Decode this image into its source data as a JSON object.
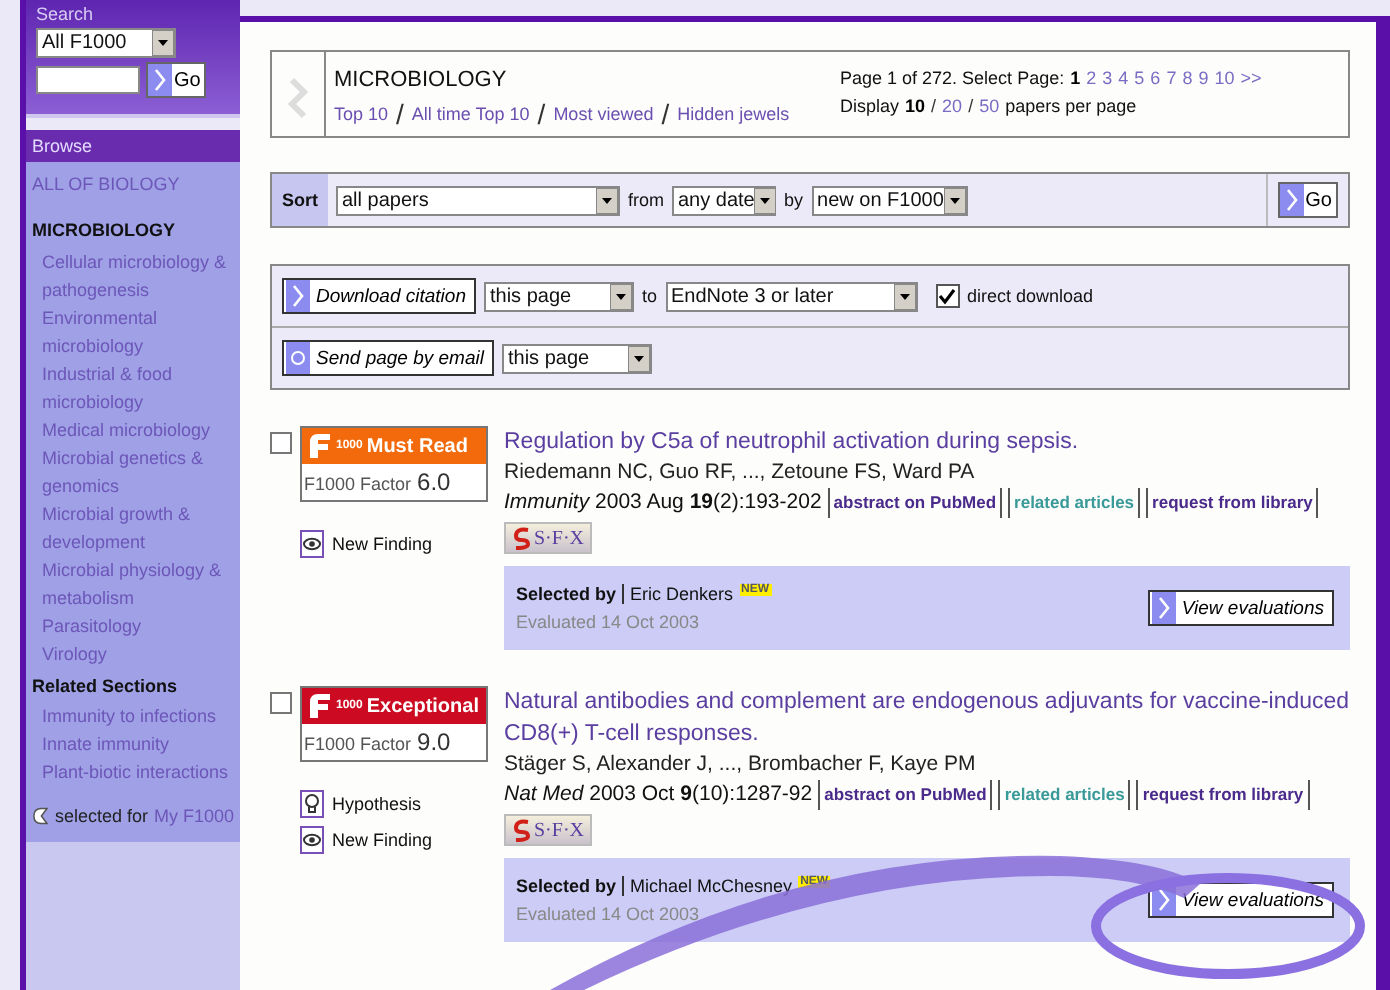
{
  "sidebar": {
    "search_label": "Search",
    "scope": "All F1000",
    "go": "Go",
    "browse": "Browse",
    "all_link": "ALL OF BIOLOGY",
    "section": "MICROBIOLOGY",
    "items": [
      "Cellular microbiology & pathogenesis",
      "Environmental microbiology",
      "Industrial & food microbiology",
      "Medical microbiology",
      "Microbial genetics & genomics",
      "Microbial growth & development",
      "Microbial physiology & metabolism",
      "Parasitology",
      "Virology"
    ],
    "related_heading": "Related Sections",
    "related": [
      "Immunity to infections",
      "Innate immunity",
      "Plant-biotic interactions"
    ],
    "footer_text": "selected for",
    "footer_link": "My F1000"
  },
  "header": {
    "title": "MICROBIOLOGY",
    "links": [
      "Top 10",
      "All time Top 10",
      "Most viewed",
      "Hidden jewels"
    ],
    "separator": "/",
    "pager_label": "Page 1 of 272. Select Page:",
    "pages": [
      {
        "label": "1",
        "selected": true
      },
      {
        "label": "2",
        "selected": false
      },
      {
        "label": "3",
        "selected": false
      },
      {
        "label": "4",
        "selected": false
      },
      {
        "label": "5",
        "selected": false
      },
      {
        "label": "6",
        "selected": false
      },
      {
        "label": "7",
        "selected": false
      },
      {
        "label": "8",
        "selected": false
      },
      {
        "label": "9",
        "selected": false
      },
      {
        "label": "10",
        "selected": false
      },
      {
        "label": ">>",
        "selected": false
      }
    ],
    "display_label": "Display",
    "display_options": [
      {
        "label": "10",
        "selected": true
      },
      {
        "label": "20",
        "selected": false
      },
      {
        "label": "50",
        "selected": false
      }
    ],
    "display_suffix": "papers per page"
  },
  "sort": {
    "label": "Sort",
    "what": "all papers",
    "from_label": "from",
    "date": "any date",
    "by_label": "by",
    "order": "new on F1000",
    "go": "Go"
  },
  "download": {
    "button": "Download citation",
    "scope": "this page",
    "to_label": "to",
    "format": "EndNote 3 or later",
    "direct_label": "direct download",
    "direct_checked": true
  },
  "email": {
    "button": "Send page by email",
    "scope": "this page"
  },
  "papers": [
    {
      "checked": false,
      "rating": {
        "kind": "must_read",
        "logo": "1000",
        "label": "Must Read"
      },
      "factor_label": "F1000 Factor",
      "factor": "6.0",
      "tags": [
        {
          "kind": "new_finding",
          "label": "New Finding"
        }
      ],
      "title": "Regulation by C5a of neutrophil activation during sepsis.",
      "authors": "Riedemann NC, Guo RF, ..., Zetoune FS, Ward PA",
      "citation": "*Immunity* 2003 Aug **19**(2):193-202",
      "links": [
        {
          "kind": "abstract",
          "label": "abstract on PubMed"
        },
        {
          "kind": "related",
          "label": "related articles"
        },
        {
          "kind": "library",
          "label": "request from library"
        }
      ],
      "sfx": "S·F·X",
      "selected_by": "Selected by",
      "evaluator": "Eric Denkers",
      "new_badge": "NEW",
      "evaluated": "Evaluated 14 Oct 2003",
      "view": "View evaluations"
    },
    {
      "checked": false,
      "rating": {
        "kind": "exceptional",
        "logo": "1000",
        "label": "Exceptional"
      },
      "factor_label": "F1000 Factor",
      "factor": "9.0",
      "tags": [
        {
          "kind": "hypothesis",
          "label": "Hypothesis"
        },
        {
          "kind": "new_finding",
          "label": "New Finding"
        }
      ],
      "title": "Natural antibodies and complement are endogenous adjuvants for vaccine-induced CD8(+) T-cell responses.",
      "authors": "Stäger S, Alexander J, ..., Brombacher F, Kaye PM",
      "citation": "*Nat Med* 2003 Oct **9**(10):1287-92",
      "links": [
        {
          "kind": "abstract",
          "label": "abstract on PubMed"
        },
        {
          "kind": "related",
          "label": "related articles"
        },
        {
          "kind": "library",
          "label": "request from library"
        }
      ],
      "sfx": "S·F·X",
      "selected_by": "Selected by",
      "evaluator": "Michael McChesney",
      "new_badge": "NEW",
      "evaluated": "Evaluated 14 Oct 2003",
      "view": "View evaluations"
    }
  ]
}
